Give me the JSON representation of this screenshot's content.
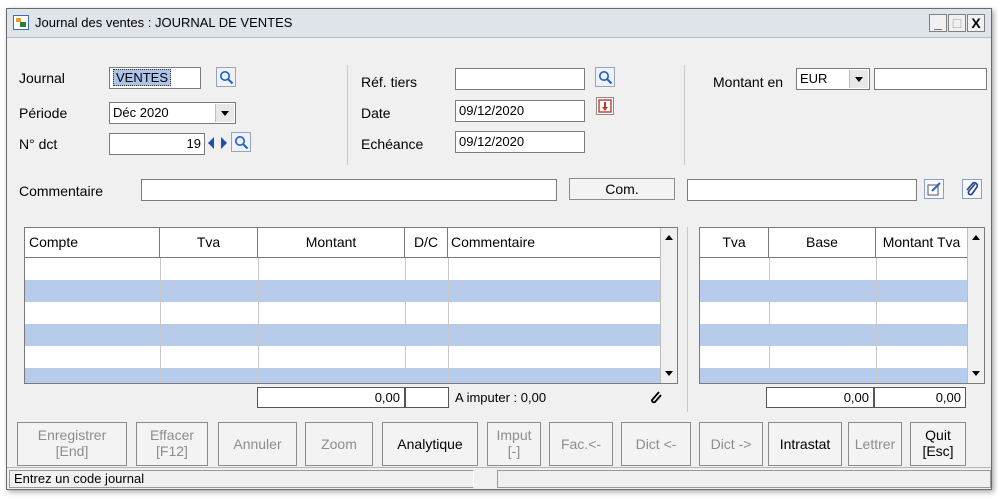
{
  "window": {
    "title": "Journal des ventes : JOURNAL DE VENTES",
    "min_label": "_",
    "max_label": "□",
    "close_label": "X"
  },
  "header": {
    "journal_label": "Journal",
    "journal_value": "VENTES",
    "periode_label": "Période",
    "periode_value": "Déc 2020",
    "ndct_label": "N° dct",
    "ndct_value": "19",
    "ref_tiers_label": "Réf. tiers",
    "ref_tiers_value": "",
    "date_label": "Date",
    "date_value": "09/12/2020",
    "echeance_label": "Echéance",
    "echeance_value": "09/12/2020",
    "montant_en_label": "Montant en",
    "currency_value": "EUR",
    "montant_value": "",
    "commentaire_label": "Commentaire",
    "commentaire_value": "",
    "com_button_label": "Com.",
    "com_field_value": ""
  },
  "main_grid": {
    "columns": [
      "Compte",
      "Tva",
      "Montant",
      "D/C",
      "Commentaire"
    ],
    "row_count": 6,
    "total_montant": "0,00",
    "a_imputer": "A imputer : 0,00"
  },
  "tva_grid": {
    "columns": [
      "Tva",
      "Base",
      "Montant Tva"
    ],
    "total_base": "0,00",
    "total_montant_tva": "0,00"
  },
  "toolbar": {
    "enregistrer_l1": "Enregistrer",
    "enregistrer_l2": "[End]",
    "effacer_l1": "Effacer",
    "effacer_l2": "[F12]",
    "annuler": "Annuler",
    "zoom": "Zoom",
    "analytique": "Analytique",
    "imput_l1": "Imput",
    "imput_l2": "[-]",
    "fac": "Fac.<-",
    "dict_back": "Dict <-",
    "dict_fwd": "Dict ->",
    "intrastat": "Intrastat",
    "lettrer": "Lettrer",
    "quit_l1": "Quit",
    "quit_l2": "[Esc]"
  },
  "status": {
    "message": "Entrez un code journal"
  },
  "icons": {
    "app": "journal-app-icon",
    "search": "magnifier-icon",
    "calendar": "calendar-icon",
    "edit": "edit-note-icon",
    "attach": "paperclip-icon"
  },
  "colors": {
    "row_alt": "#b7cbea",
    "selection": "#aac4ea",
    "window_bg": "#f0f0f0"
  }
}
